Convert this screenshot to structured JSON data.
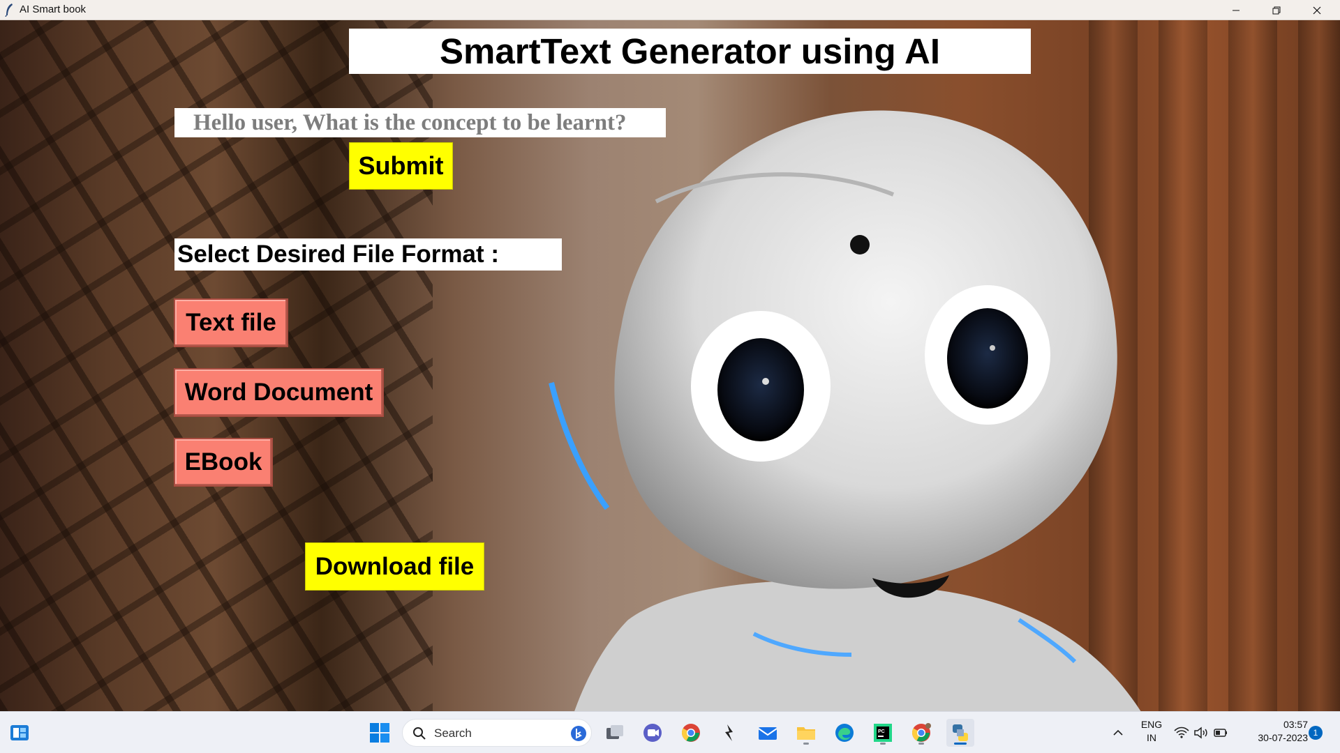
{
  "window": {
    "title": "AI Smart book"
  },
  "main": {
    "header_title": "SmartText Generator using AI",
    "query_placeholder": "Hello user, What is the concept to be learnt?",
    "submit_label": "Submit",
    "format_label": "Select Desired File Format :",
    "format_options": [
      {
        "label": "Text file"
      },
      {
        "label": "Word Document"
      },
      {
        "label": "EBook"
      }
    ],
    "download_label": "Download file"
  },
  "taskbar": {
    "search_label": "Search",
    "language_line1": "ENG",
    "language_line2": "IN",
    "time": "03:57",
    "date": "30-07-2023",
    "notification_count": "1",
    "pinned_apps": [
      "widgets-icon",
      "start-icon",
      "search-icon",
      "bing-icon",
      "task-view-icon",
      "teams-icon",
      "chrome-icon",
      "klack-icon",
      "mail-icon",
      "file-explorer-icon",
      "edge-icon",
      "pycharm-icon",
      "chrome-profile-icon",
      "python-icon"
    ]
  },
  "colors": {
    "accent_yellow": "#ffff00",
    "accent_salmon": "#fa8072",
    "title_bar": "#f3efeb",
    "taskbar": "#eef0f6",
    "windows_blue": "#0067c0"
  }
}
